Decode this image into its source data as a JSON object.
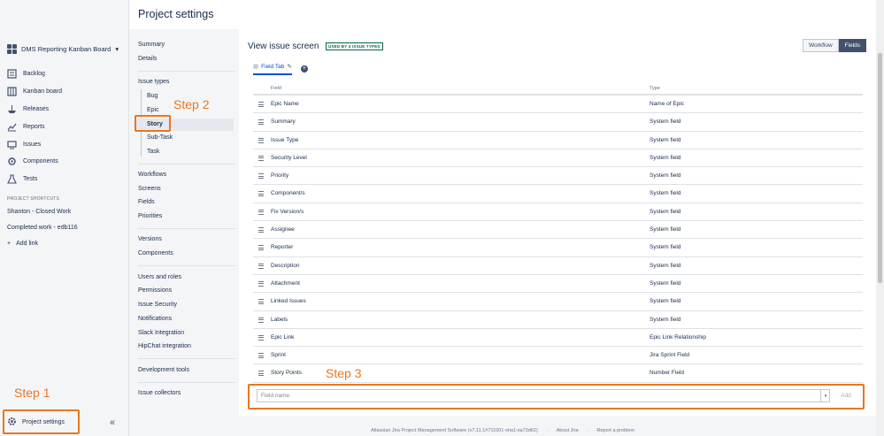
{
  "sidebar": {
    "project_name": "DMS Reporting Kanban Board",
    "nav": [
      {
        "label": "Backlog",
        "icon": "backlog-icon"
      },
      {
        "label": "Kanban board",
        "icon": "board-icon"
      },
      {
        "label": "Releases",
        "icon": "ship-icon"
      },
      {
        "label": "Reports",
        "icon": "chart-icon"
      },
      {
        "label": "Issues",
        "icon": "issues-icon"
      },
      {
        "label": "Components",
        "icon": "puzzle-icon"
      },
      {
        "label": "Tests",
        "icon": "flask-icon"
      }
    ],
    "shortcuts_title": "PROJECT SHORTCUTS",
    "shortcuts": [
      "Shanton - Closed Work",
      "Completed work - edb116"
    ],
    "add_link": "Add link",
    "settings_label": "Project settings",
    "collapse": "«"
  },
  "annotations": {
    "step1": "Step 1",
    "step2": "Step 2",
    "step3": "Step 3"
  },
  "page_title": "Project settings",
  "settings_nav": {
    "summary": "Summary",
    "details": "Details",
    "issue_types": "Issue types",
    "bug": "Bug",
    "epic": "Epic",
    "story": "Story",
    "subtask": "Sub-Task",
    "task": "Task",
    "workflows": "Workflows",
    "screens": "Screens",
    "fields": "Fields",
    "priorities": "Priorities",
    "versions": "Versions",
    "components": "Components",
    "users_roles": "Users and roles",
    "permissions": "Permissions",
    "issue_security": "Issue Security",
    "notifications": "Notifications",
    "slack": "Slack Integration",
    "hipchat": "HipChat integration",
    "dev_tools": "Development tools",
    "issue_collectors": "Issue collectors"
  },
  "screen": {
    "title": "View issue screen",
    "badge": "USED BY 4 ISSUE TYPES",
    "workflow_btn": "Workflow",
    "fields_btn": "Fields",
    "tab_label": "Field Tab",
    "col_field": "Field",
    "col_type": "Type",
    "rows": [
      {
        "field": "Epic Name",
        "type": "Name of Epic"
      },
      {
        "field": "Summary",
        "type": "System field"
      },
      {
        "field": "Issue Type",
        "type": "System field"
      },
      {
        "field": "Security Level",
        "type": "System field"
      },
      {
        "field": "Priority",
        "type": "System field"
      },
      {
        "field": "Component/s",
        "type": "System field"
      },
      {
        "field": "Fix Version/s",
        "type": "System field"
      },
      {
        "field": "Assignee",
        "type": "System field"
      },
      {
        "field": "Reporter",
        "type": "System field"
      },
      {
        "field": "Description",
        "type": "System field"
      },
      {
        "field": "Attachment",
        "type": "System field"
      },
      {
        "field": "Linked Issues",
        "type": "System field"
      },
      {
        "field": "Labels",
        "type": "System field"
      },
      {
        "field": "Epic Link",
        "type": "Epic Link Relationship"
      },
      {
        "field": "Sprint",
        "type": "Jira Sprint Field"
      },
      {
        "field": "Story Points",
        "type": "Number Field"
      }
    ],
    "field_placeholder": "Field name",
    "add_label": "Add"
  },
  "footer": {
    "version": "Atlassian Jira Project Management Software (v7.11.1#711001-sha1:ea73d62)",
    "about": "About Jira",
    "report": "Report a problem"
  }
}
